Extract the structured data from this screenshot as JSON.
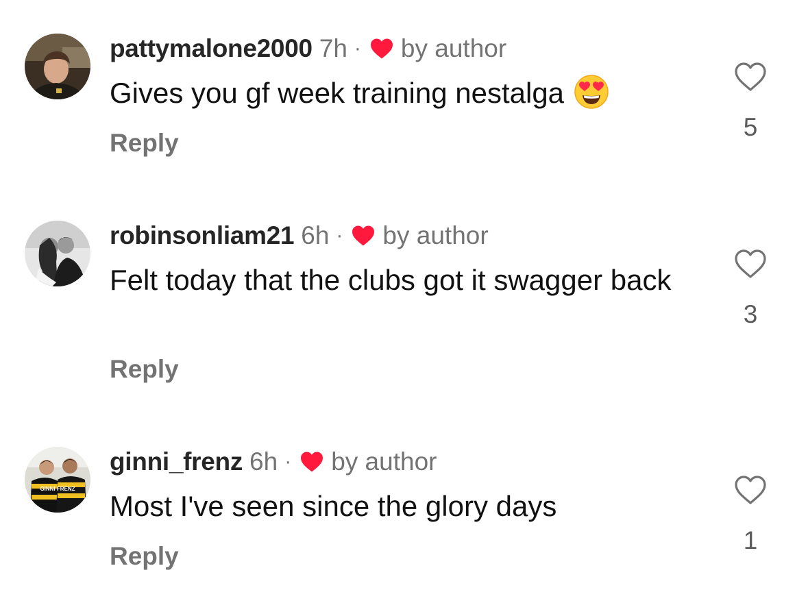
{
  "colors": {
    "author_heart": "#ff1a3d",
    "muted_text": "#737373",
    "username": "#262626"
  },
  "comments": [
    {
      "username": "pattymalone2000",
      "time": "7h",
      "separator": "·",
      "author_badge": "by author",
      "text": "Gives you gf week training nestalga",
      "emoji": "heart-eyes-emoji",
      "reply_label": "Reply",
      "like_icon": "heart-outline-icon",
      "likes": "5"
    },
    {
      "username": "robinsonliam21",
      "time": "6h",
      "separator": "·",
      "author_badge": "by author",
      "text": "Felt today that the clubs got it swagger back",
      "reply_label": "Reply",
      "like_icon": "heart-outline-icon",
      "likes": "3"
    },
    {
      "username": "ginni_frenz",
      "time": "6h",
      "separator": "·",
      "author_badge": "by author",
      "text": "Most I've seen since the glory days",
      "avatar_caption": "GINNI FRENZ",
      "reply_label": "Reply",
      "like_icon": "heart-outline-icon",
      "likes": "1"
    }
  ]
}
